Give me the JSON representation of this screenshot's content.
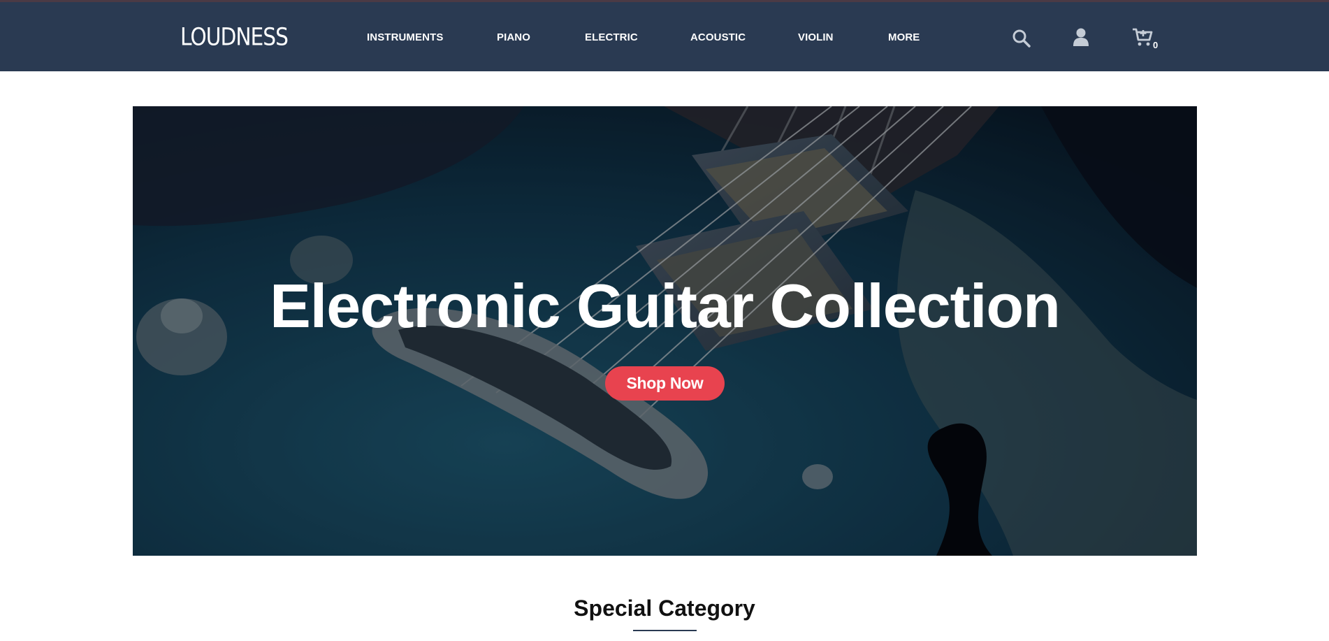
{
  "header": {
    "logo": "LOUDNESS",
    "nav": [
      "INSTRUMENTS",
      "PIANO",
      "ELECTRIC",
      "ACOUSTIC",
      "VIOLIN",
      "MORE"
    ],
    "icons": [
      "search-icon",
      "user-icon",
      "cart-icon"
    ],
    "cart_count": "0",
    "colors": {
      "bar": "#2a3a52",
      "text": "#ffffff"
    }
  },
  "hero": {
    "title": "Electronic Guitar Collection",
    "button_label": "Shop Now",
    "colors": {
      "button": "#e8434f"
    }
  },
  "section": {
    "title": "Special Category"
  }
}
